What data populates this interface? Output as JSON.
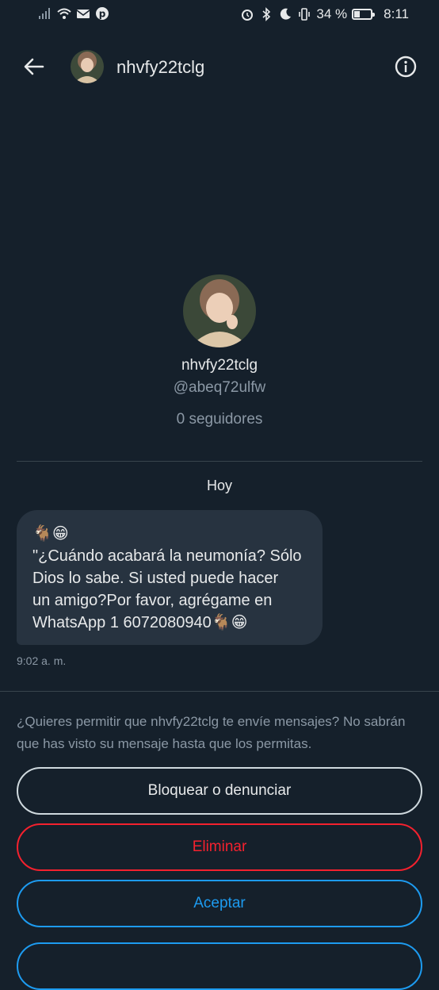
{
  "status_bar": {
    "battery": "34 %",
    "time": "8:11",
    "battery_level": 0.34
  },
  "header": {
    "title": "nhvfy22tclg"
  },
  "profile": {
    "name": "nhvfy22tclg",
    "handle": "@abeq72ulfw",
    "followers": "0 seguidores"
  },
  "conversation": {
    "day_label": "Hoy",
    "message": {
      "line1": "🐐😁",
      "line2": "\"¿Cuándo acabará la neumonía? Sólo",
      "line3": "Dios lo sabe. Si usted puede hacer",
      "line4": "un amigo?Por favor, agrégame en",
      "line5": "WhatsApp 1 6072080940🐐😁"
    },
    "time": "9:02 a. m."
  },
  "request": {
    "prompt": "¿Quieres permitir que nhvfy22tclg te envíe mensajes? No sabrán que has visto su mensaje hasta que los permitas.",
    "block_label": "Bloquear o denunciar",
    "delete_label": "Eliminar",
    "accept_label": "Aceptar"
  },
  "colors": {
    "background": "#15202b",
    "bubble": "#273340",
    "danger": "#f4212e",
    "accent": "#1d9bf0"
  }
}
